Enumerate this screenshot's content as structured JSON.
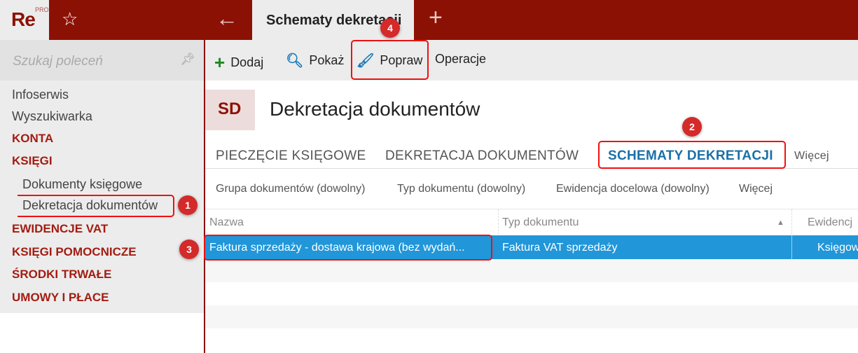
{
  "app": {
    "logo": "Re",
    "logo_badge": "PRO",
    "active_tab": "Schematy dekretacji"
  },
  "sidebar": {
    "search_placeholder": "Szukaj poleceń",
    "items": [
      {
        "label": "Infoserwis",
        "type": "link"
      },
      {
        "label": "Wyszukiwarka",
        "type": "link"
      },
      {
        "label": "KONTA",
        "type": "section"
      },
      {
        "label": "KSIĘGI",
        "type": "section"
      },
      {
        "label": "Dokumenty księgowe",
        "type": "sub"
      },
      {
        "label": "Dekretacja dokumentów",
        "type": "sub",
        "selected": true
      },
      {
        "label": "EWIDENCJE VAT",
        "type": "section"
      },
      {
        "label": "KSIĘGI POMOCNICZE",
        "type": "section"
      },
      {
        "label": "ŚRODKI TRWAŁE",
        "type": "section"
      },
      {
        "label": "UMOWY I PŁACE",
        "type": "section"
      }
    ]
  },
  "toolbar": {
    "add": "Dodaj",
    "show": "Pokaż",
    "edit": "Popraw",
    "operations": "Operacje"
  },
  "page": {
    "badge": "SD",
    "title": "Dekretacja dokumentów",
    "tabs": [
      "PIECZĘCIE KSIĘGOWE",
      "DEKRETACJA DOKUMENTÓW",
      "SCHEMATY DEKRETACJI",
      "Więcej"
    ],
    "filters": [
      "Grupa dokumentów (dowolny)",
      "Typ dokumentu (dowolny)",
      "Ewidencja docelowa (dowolny)",
      "Więcej"
    ]
  },
  "table": {
    "columns": [
      "Nazwa",
      "Typ dokumentu",
      "Ewidencj"
    ],
    "rows": [
      [
        "Faktura sprzedaży - dostawa krajowa (bez wydań...",
        "Faktura VAT sprzedaży",
        "Księgow"
      ]
    ]
  },
  "annotations": [
    "1",
    "2",
    "3",
    "4"
  ],
  "colors": {
    "brand": "#8c1105",
    "selection": "#2196d9",
    "accent": "#1a70a8",
    "annotation": "#d42a2a"
  }
}
